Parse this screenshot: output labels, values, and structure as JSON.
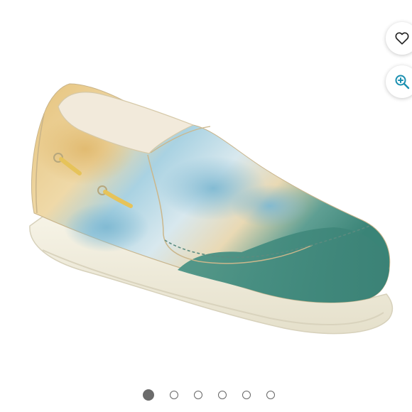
{
  "product": {
    "image_subject": "sneaker-photo",
    "colors": {
      "sand": "#e3c27e",
      "cream": "#f4ecd9",
      "sky": "#8fc4d8",
      "teal": "#3f8a7e",
      "sole": "#f1eedd",
      "lace": "#e6c35a"
    }
  },
  "actions": {
    "favorite_icon": "heart-outline-icon",
    "zoom_icon": "zoom-in-icon",
    "accent": "#1a8fb0"
  },
  "carousel": {
    "slides": 6,
    "active_index": 0
  }
}
